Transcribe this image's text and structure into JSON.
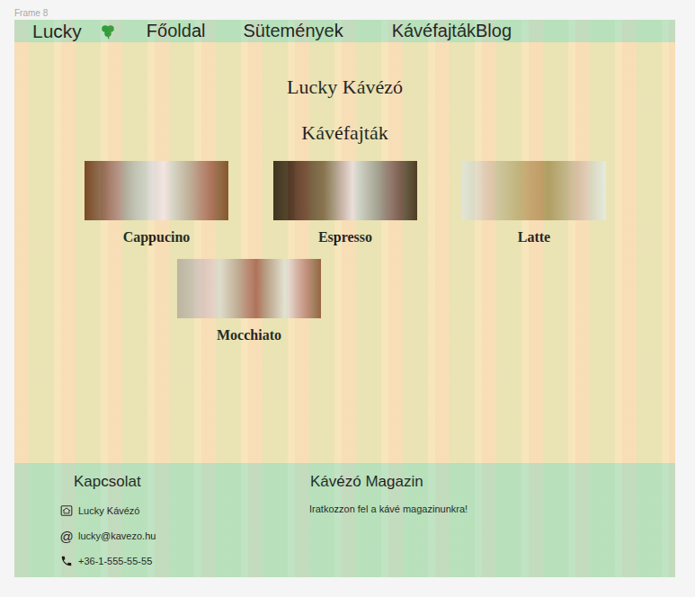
{
  "frame": {
    "label": "Frame 8"
  },
  "nav": {
    "brand": "Lucky",
    "items": [
      {
        "label": "Főoldal"
      },
      {
        "label": "Sütemények"
      },
      {
        "label": "Kávéfajták"
      },
      {
        "label": "Blog"
      }
    ]
  },
  "main": {
    "title": "Lucky Kávézó",
    "subtitle": "Kávéfajták",
    "cards": [
      {
        "caption": "Cappucino"
      },
      {
        "caption": "Espresso"
      },
      {
        "caption": "Latte"
      },
      {
        "caption": "Mocchiato"
      }
    ]
  },
  "footer": {
    "contact": {
      "title": "Kapcsolat",
      "items": [
        {
          "kind": "home",
          "icon": "",
          "text": "Lucky Kávézó"
        },
        {
          "kind": "at",
          "icon": "@",
          "text": "lucky@kavezo.hu"
        },
        {
          "kind": "phone",
          "icon": "",
          "text": "+36-1-555-55-55"
        }
      ]
    },
    "magazine": {
      "title": "Kávézó Magazin",
      "text": "Iratkozzon fel a kávé magazinunkra!"
    }
  }
}
